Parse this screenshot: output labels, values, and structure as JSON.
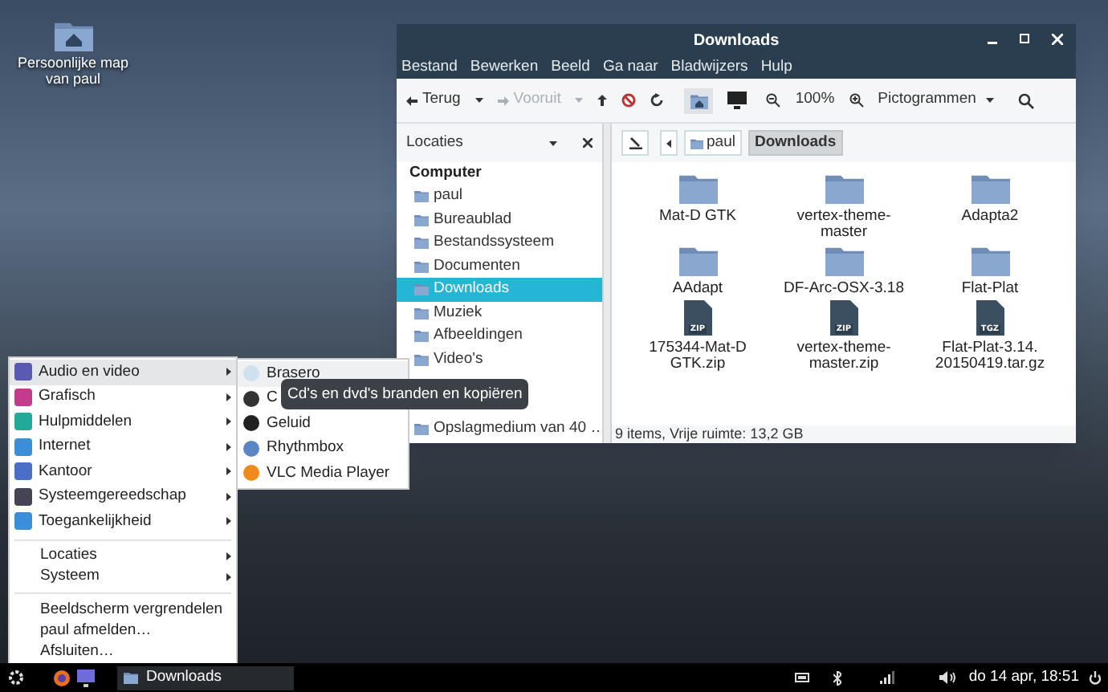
{
  "desktop_icons": [
    {
      "label": "Persoonlijke map van paul"
    }
  ],
  "window": {
    "title": "Downloads",
    "menubar": [
      "Bestand",
      "Bewerken",
      "Beeld",
      "Ga naar",
      "Bladwijzers",
      "Hulp"
    ],
    "toolbar": {
      "back": {
        "label": "Terug",
        "disabled": false
      },
      "forward": {
        "label": "Vooruit",
        "disabled": true
      },
      "zoom": "100%",
      "view": "Pictogrammen"
    },
    "sidebar": {
      "title": "Locaties",
      "sections": [
        {
          "heading": "Computer",
          "items": [
            {
              "label": "paul",
              "selected": false
            },
            {
              "label": "Bureaublad",
              "selected": false
            },
            {
              "label": "Bestandssysteem",
              "selected": false
            },
            {
              "label": "Documenten",
              "selected": false
            },
            {
              "label": "Downloads",
              "selected": true
            },
            {
              "label": "Muziek",
              "selected": false
            },
            {
              "label": "Afbeeldingen",
              "selected": false
            },
            {
              "label": "Video's",
              "selected": false
            }
          ]
        },
        {
          "items": [
            {
              "label": "Opslagmedium van 40 …",
              "selected": false
            }
          ]
        }
      ]
    },
    "path": [
      {
        "label": "paul",
        "selected": false
      },
      {
        "label": "Downloads",
        "selected": true
      }
    ],
    "files": [
      {
        "name": "Mat-D GTK",
        "kind": "folder"
      },
      {
        "name": "vertex-theme-master",
        "kind": "folder"
      },
      {
        "name": "Adapta2",
        "kind": "folder"
      },
      {
        "name": "AAdapt",
        "kind": "folder"
      },
      {
        "name": "DF-Arc-OSX-3.18",
        "kind": "folder"
      },
      {
        "name": "Flat-Plat",
        "kind": "folder"
      },
      {
        "name": "175344-Mat-D GTK.zip",
        "kind": "archive",
        "badge": "ZIP"
      },
      {
        "name": "vertex-theme-master.zip",
        "kind": "archive",
        "badge": "ZIP"
      },
      {
        "name": "Flat-Plat-3.14. 20150419.tar.gz",
        "kind": "archive",
        "badge": "TGZ"
      }
    ],
    "status": "9 items, Vrije ruimte: 13,2 GB"
  },
  "app_menu": {
    "categories": [
      {
        "label": "Audio en video",
        "selected": true
      },
      {
        "label": "Grafisch",
        "selected": false
      },
      {
        "label": "Hulpmiddelen",
        "selected": false
      },
      {
        "label": "Internet",
        "selected": false
      },
      {
        "label": "Kantoor",
        "selected": false
      },
      {
        "label": "Systeemgereedschap",
        "selected": false
      },
      {
        "label": "Toegankelijkheid",
        "selected": false
      }
    ],
    "places": [
      "Locaties",
      "Systeem"
    ],
    "actions": [
      "Beeldscherm vergrendelen",
      "paul afmelden…",
      "Afsluiten…"
    ],
    "submenu": [
      {
        "label": "Brasero",
        "selected": true
      },
      {
        "label": "C",
        "selected": false
      },
      {
        "label": "Geluid",
        "selected": false
      },
      {
        "label": "Rhythmbox",
        "selected": false
      },
      {
        "label": "VLC Media Player",
        "selected": false
      }
    ],
    "tooltip": "Cd's en dvd's branden en kopiëren"
  },
  "taskbar": {
    "tasks": [
      {
        "label": "Downloads"
      }
    ],
    "clock": "do 14 apr, 18:51"
  }
}
